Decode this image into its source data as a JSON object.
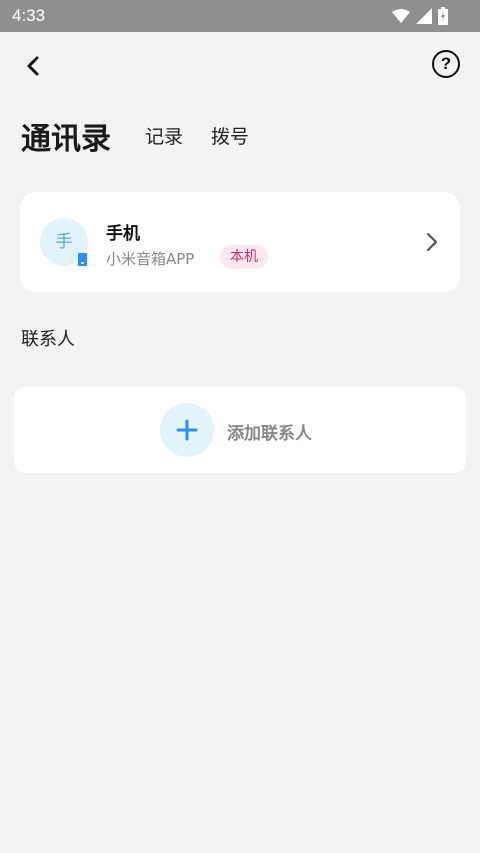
{
  "status_bar": {
    "time": "4:33",
    "icons": [
      "wifi-icon",
      "cellular-signal-icon",
      "battery-charging-icon"
    ]
  },
  "header": {
    "back_icon": "chevron-left-icon",
    "help_label": "?"
  },
  "tabs": [
    {
      "label": "通讯录",
      "active": true
    },
    {
      "label": "记录",
      "active": false
    },
    {
      "label": "拨号",
      "active": false
    }
  ],
  "device": {
    "avatar_text": "手",
    "name": "手机",
    "subtitle": "小米音箱APP",
    "tag": "本机"
  },
  "contacts": {
    "section_title": "联系人",
    "add_label": "添加联系人"
  },
  "colors": {
    "accent": "#2f8ef0",
    "tag_text": "#d02f6a",
    "tag_bg": "#fde8f1",
    "avatar_bg": "#e3f3fb"
  }
}
